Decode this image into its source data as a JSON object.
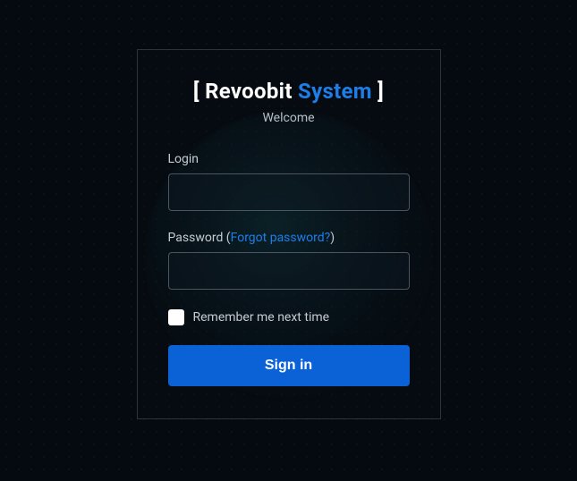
{
  "brand": {
    "open_bracket": "[ ",
    "name_main": "Revoobit ",
    "name_accent": "System",
    "close_bracket": " ]"
  },
  "welcome_text": "Welcome",
  "login": {
    "label": "Login",
    "value": ""
  },
  "password": {
    "label_prefix": "Password (",
    "forgot_text": "Forgot password?",
    "label_suffix": ")",
    "value": ""
  },
  "remember": {
    "label": "Remember me next time",
    "checked": false
  },
  "signin_label": "Sign in"
}
